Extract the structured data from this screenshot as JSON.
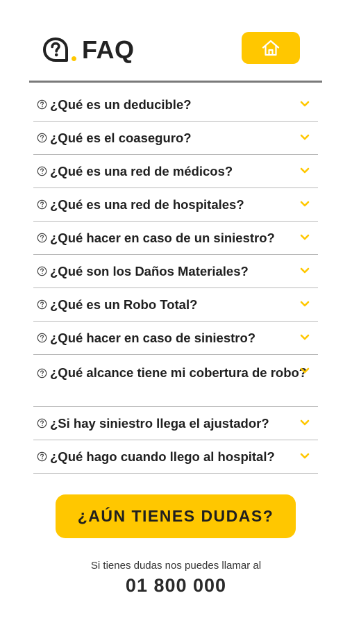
{
  "header": {
    "title": "FAQ",
    "home_icon": "home-icon",
    "logo_icon": "question-bubble-icon"
  },
  "colors": {
    "accent": "#FFC700",
    "text": "#1f1f1f",
    "divider": "#b9b9b9"
  },
  "faq": {
    "items": [
      {
        "question": "¿Qué es un deducible?"
      },
      {
        "question": "¿Qué es el coaseguro?"
      },
      {
        "question": "¿Qué es una red de médicos?"
      },
      {
        "question": "¿Qué es una red de hospitales?"
      },
      {
        "question": "¿Qué hacer en caso de un siniestro?"
      },
      {
        "question": "¿Qué son los Daños Materiales?"
      },
      {
        "question": "¿Qué es un Robo Total?"
      },
      {
        "question": "¿Qué hacer en caso de siniestro?"
      },
      {
        "question": "¿Qué alcance tiene mi cobertura de robo?"
      },
      {
        "question": "¿Si hay siniestro llega el ajustador?"
      },
      {
        "question": "¿Qué hago cuando llego al hospital?"
      }
    ]
  },
  "cta": {
    "label": "¿AÚN TIENES DUDAS?"
  },
  "contact": {
    "note": "Si tienes dudas nos puedes llamar al",
    "phone": "01 800 000"
  }
}
